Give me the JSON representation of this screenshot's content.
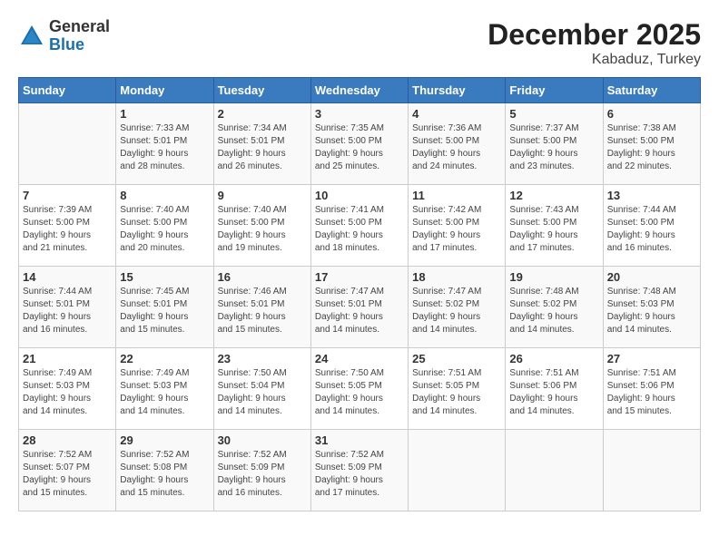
{
  "header": {
    "logo": {
      "general": "General",
      "blue": "Blue"
    },
    "title": "December 2025",
    "location": "Kabaduz, Turkey"
  },
  "columns": [
    "Sunday",
    "Monday",
    "Tuesday",
    "Wednesday",
    "Thursday",
    "Friday",
    "Saturday"
  ],
  "weeks": [
    [
      {
        "day": "",
        "info": ""
      },
      {
        "day": "1",
        "info": "Sunrise: 7:33 AM\nSunset: 5:01 PM\nDaylight: 9 hours\nand 28 minutes."
      },
      {
        "day": "2",
        "info": "Sunrise: 7:34 AM\nSunset: 5:01 PM\nDaylight: 9 hours\nand 26 minutes."
      },
      {
        "day": "3",
        "info": "Sunrise: 7:35 AM\nSunset: 5:00 PM\nDaylight: 9 hours\nand 25 minutes."
      },
      {
        "day": "4",
        "info": "Sunrise: 7:36 AM\nSunset: 5:00 PM\nDaylight: 9 hours\nand 24 minutes."
      },
      {
        "day": "5",
        "info": "Sunrise: 7:37 AM\nSunset: 5:00 PM\nDaylight: 9 hours\nand 23 minutes."
      },
      {
        "day": "6",
        "info": "Sunrise: 7:38 AM\nSunset: 5:00 PM\nDaylight: 9 hours\nand 22 minutes."
      }
    ],
    [
      {
        "day": "7",
        "info": "Sunrise: 7:39 AM\nSunset: 5:00 PM\nDaylight: 9 hours\nand 21 minutes."
      },
      {
        "day": "8",
        "info": "Sunrise: 7:40 AM\nSunset: 5:00 PM\nDaylight: 9 hours\nand 20 minutes."
      },
      {
        "day": "9",
        "info": "Sunrise: 7:40 AM\nSunset: 5:00 PM\nDaylight: 9 hours\nand 19 minutes."
      },
      {
        "day": "10",
        "info": "Sunrise: 7:41 AM\nSunset: 5:00 PM\nDaylight: 9 hours\nand 18 minutes."
      },
      {
        "day": "11",
        "info": "Sunrise: 7:42 AM\nSunset: 5:00 PM\nDaylight: 9 hours\nand 17 minutes."
      },
      {
        "day": "12",
        "info": "Sunrise: 7:43 AM\nSunset: 5:00 PM\nDaylight: 9 hours\nand 17 minutes."
      },
      {
        "day": "13",
        "info": "Sunrise: 7:44 AM\nSunset: 5:00 PM\nDaylight: 9 hours\nand 16 minutes."
      }
    ],
    [
      {
        "day": "14",
        "info": "Sunrise: 7:44 AM\nSunset: 5:01 PM\nDaylight: 9 hours\nand 16 minutes."
      },
      {
        "day": "15",
        "info": "Sunrise: 7:45 AM\nSunset: 5:01 PM\nDaylight: 9 hours\nand 15 minutes."
      },
      {
        "day": "16",
        "info": "Sunrise: 7:46 AM\nSunset: 5:01 PM\nDaylight: 9 hours\nand 15 minutes."
      },
      {
        "day": "17",
        "info": "Sunrise: 7:47 AM\nSunset: 5:01 PM\nDaylight: 9 hours\nand 14 minutes."
      },
      {
        "day": "18",
        "info": "Sunrise: 7:47 AM\nSunset: 5:02 PM\nDaylight: 9 hours\nand 14 minutes."
      },
      {
        "day": "19",
        "info": "Sunrise: 7:48 AM\nSunset: 5:02 PM\nDaylight: 9 hours\nand 14 minutes."
      },
      {
        "day": "20",
        "info": "Sunrise: 7:48 AM\nSunset: 5:03 PM\nDaylight: 9 hours\nand 14 minutes."
      }
    ],
    [
      {
        "day": "21",
        "info": "Sunrise: 7:49 AM\nSunset: 5:03 PM\nDaylight: 9 hours\nand 14 minutes."
      },
      {
        "day": "22",
        "info": "Sunrise: 7:49 AM\nSunset: 5:03 PM\nDaylight: 9 hours\nand 14 minutes."
      },
      {
        "day": "23",
        "info": "Sunrise: 7:50 AM\nSunset: 5:04 PM\nDaylight: 9 hours\nand 14 minutes."
      },
      {
        "day": "24",
        "info": "Sunrise: 7:50 AM\nSunset: 5:05 PM\nDaylight: 9 hours\nand 14 minutes."
      },
      {
        "day": "25",
        "info": "Sunrise: 7:51 AM\nSunset: 5:05 PM\nDaylight: 9 hours\nand 14 minutes."
      },
      {
        "day": "26",
        "info": "Sunrise: 7:51 AM\nSunset: 5:06 PM\nDaylight: 9 hours\nand 14 minutes."
      },
      {
        "day": "27",
        "info": "Sunrise: 7:51 AM\nSunset: 5:06 PM\nDaylight: 9 hours\nand 15 minutes."
      }
    ],
    [
      {
        "day": "28",
        "info": "Sunrise: 7:52 AM\nSunset: 5:07 PM\nDaylight: 9 hours\nand 15 minutes."
      },
      {
        "day": "29",
        "info": "Sunrise: 7:52 AM\nSunset: 5:08 PM\nDaylight: 9 hours\nand 15 minutes."
      },
      {
        "day": "30",
        "info": "Sunrise: 7:52 AM\nSunset: 5:09 PM\nDaylight: 9 hours\nand 16 minutes."
      },
      {
        "day": "31",
        "info": "Sunrise: 7:52 AM\nSunset: 5:09 PM\nDaylight: 9 hours\nand 17 minutes."
      },
      {
        "day": "",
        "info": ""
      },
      {
        "day": "",
        "info": ""
      },
      {
        "day": "",
        "info": ""
      }
    ]
  ]
}
